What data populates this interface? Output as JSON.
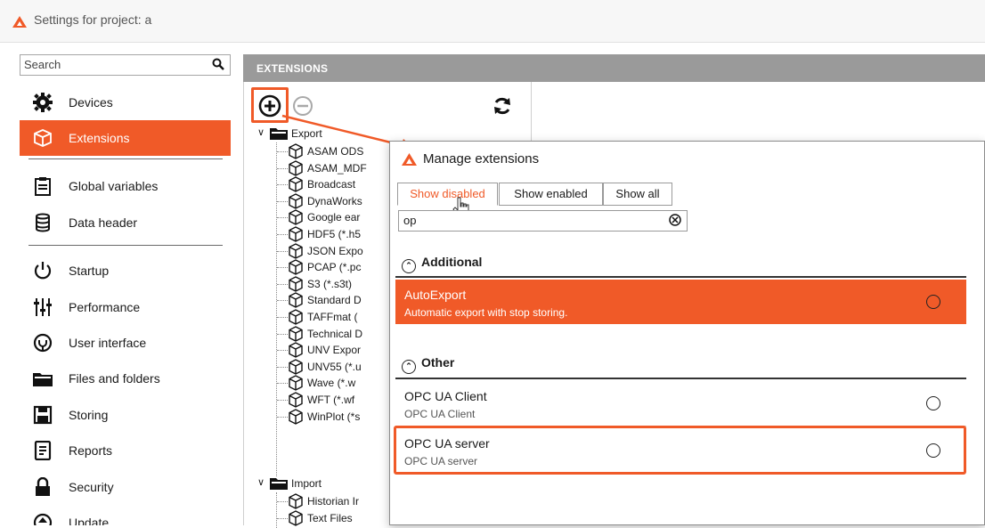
{
  "window": {
    "title": "Settings for project: a"
  },
  "search": {
    "placeholder": "Search"
  },
  "nav": [
    {
      "label": "Devices",
      "icon": "gear-icon"
    },
    {
      "label": "Extensions",
      "icon": "package-icon",
      "active": true
    },
    {
      "label": "Global variables",
      "icon": "clipboard-icon"
    },
    {
      "label": "Data header",
      "icon": "database-icon"
    },
    {
      "label": "Startup",
      "icon": "power-icon"
    },
    {
      "label": "Performance",
      "icon": "sliders-icon"
    },
    {
      "label": "User interface",
      "icon": "user-interface-icon"
    },
    {
      "label": "Files and folders",
      "icon": "folder-icon"
    },
    {
      "label": "Storing",
      "icon": "save-icon"
    },
    {
      "label": "Reports",
      "icon": "report-icon"
    },
    {
      "label": "Security",
      "icon": "lock-icon"
    },
    {
      "label": "Update",
      "icon": "update-icon"
    }
  ],
  "extensions_header": "EXTENSIONS",
  "tree": {
    "export_label": "Export",
    "export_items": [
      "ASAM ODS",
      "ASAM_MDF",
      "Broadcast",
      "DynaWorks",
      "Google ear",
      "HDF5 (*.h5",
      "JSON Expo",
      "PCAP (*.pc",
      "S3 (*.s3t)",
      "Standard D",
      "TAFFmat (",
      "Technical D",
      "UNV Expor",
      "UNV55 (*.u",
      "Wave (*.w",
      "WFT (*.wf",
      "WinPlot (*s"
    ],
    "import_label": "Import",
    "import_items": [
      "Historian Ir",
      "Text Files"
    ]
  },
  "dialog": {
    "title": "Manage extensions",
    "tabs": [
      "Show disabled",
      "Show enabled",
      "Show all"
    ],
    "filter_value": "op",
    "groups": [
      {
        "name": "Additional",
        "items": [
          {
            "name": "AutoExport",
            "desc": "Automatic export with stop storing."
          }
        ]
      },
      {
        "name": "Other",
        "items": [
          {
            "name": "OPC UA Client",
            "desc": "OPC UA Client"
          },
          {
            "name": "OPC UA server",
            "desc": "OPC UA server"
          }
        ]
      }
    ]
  },
  "colors": {
    "accent": "#f05a28",
    "header_bg": "#9a9a9a"
  }
}
